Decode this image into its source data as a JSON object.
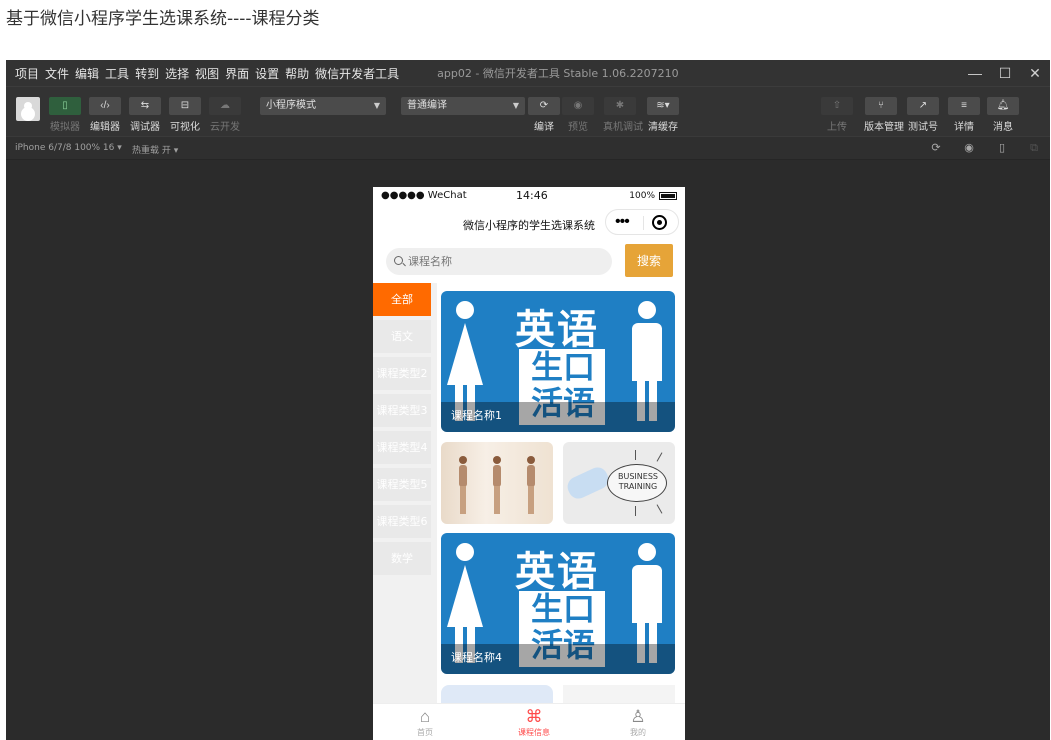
{
  "page": {
    "heading": "基于微信小程序学生选课系统----课程分类"
  },
  "ide": {
    "menu": [
      "项目",
      "文件",
      "编辑",
      "工具",
      "转到",
      "选择",
      "视图",
      "界面",
      "设置",
      "帮助",
      "微信开发者工具"
    ],
    "window_title": "app02 - 微信开发者工具 Stable 1.06.2207210",
    "window_controls": {
      "minimize": "—",
      "maximize": "☐",
      "close": "✕"
    },
    "toolbar": {
      "simulator": "模拟器",
      "editor": "编辑器",
      "debugger": "调试器",
      "visual": "可视化",
      "cloud": "云开发",
      "mode_select": "小程序模式",
      "compile_select": "普通编译",
      "compile": "编译",
      "preview": "预览",
      "remote_debug": "真机调试",
      "clear_cache": "清缓存",
      "upload": "上传",
      "version": "版本管理",
      "test_id": "测试号",
      "details": "详情",
      "messages": "消息"
    },
    "simbar": {
      "device": "iPhone 6/7/8 100% 16 ▾",
      "hot_reload": "热重载 开 ▾"
    }
  },
  "phone": {
    "status": {
      "carrier": "●●●●● WeChat",
      "time": "14:46",
      "battery": "100%"
    },
    "nav_title": "微信小程序的学生选课系统",
    "search": {
      "placeholder": "课程名称",
      "button": "搜索"
    },
    "categories": [
      "全部",
      "语文",
      "课程类型2",
      "课程类型3",
      "课程类型4",
      "课程类型5",
      "课程类型6",
      "数学"
    ],
    "banner_text": {
      "top": "英语",
      "mid1": "生口",
      "mid2": "活语"
    },
    "training_text": "BUSINESS TRAINING",
    "courses": [
      {
        "name": "课程名称1"
      },
      {
        "name": "课程名称4"
      }
    ],
    "tabs": [
      {
        "label": "首页",
        "icon": "home-icon"
      },
      {
        "label": "课程信息",
        "icon": "grid-icon"
      },
      {
        "label": "我的",
        "icon": "user-icon"
      }
    ]
  },
  "colors": {
    "accent": "#ff6a00",
    "search_button": "#e6a438",
    "banner": "#1f7fc4",
    "tab_active": "#ff4a4a"
  }
}
